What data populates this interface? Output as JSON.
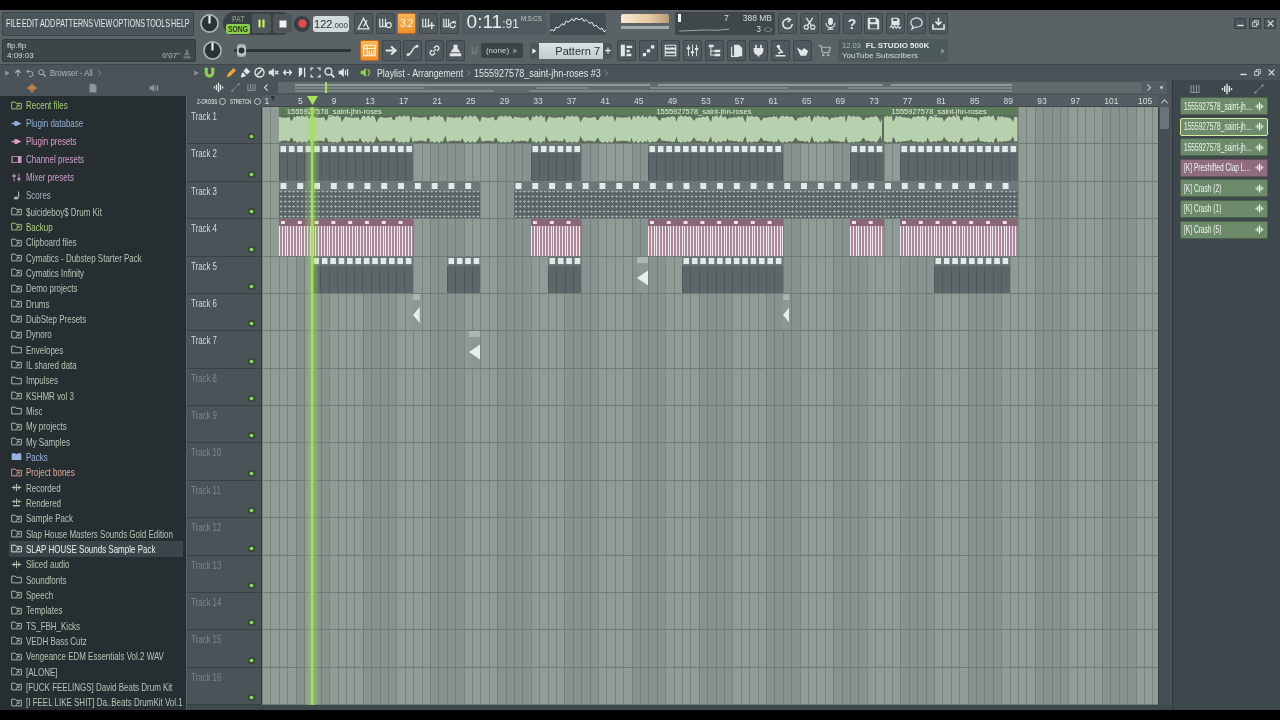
{
  "menu": [
    "FILE",
    "EDIT",
    "ADD",
    "PATTERNS",
    "VIEW",
    "OPTIONS",
    "TOOLS",
    "HELP"
  ],
  "project": {
    "file": "flp.flp",
    "position": "4:09:03",
    "duration": "0'07\""
  },
  "transport": {
    "modes": [
      {
        "label": "PAT",
        "selected": false
      },
      {
        "label": "SONG",
        "selected": true
      }
    ],
    "playing": true,
    "tempo": "122",
    "tempo_decimals": ".000"
  },
  "record_options": [
    {
      "kind": "metronome",
      "on": false
    },
    {
      "kind": "wait",
      "on": false
    },
    {
      "kind": "countdown",
      "label": "3.2",
      "on": true
    },
    {
      "kind": "blend",
      "on": false
    },
    {
      "kind": "loop",
      "on": false
    }
  ],
  "time": {
    "value": "0:11",
    "centiseconds": ":91",
    "unit": "M:S:CS"
  },
  "monitor": {
    "readout_1": "7",
    "memory": "388 MB",
    "readout_2": "3"
  },
  "help": {
    "label": "?"
  },
  "song_position": {
    "level": 0.06
  },
  "view_buttons": [
    {
      "kind": "playlist",
      "on": true
    },
    {
      "kind": "arrow",
      "on": false
    },
    {
      "kind": "curve",
      "on": false
    },
    {
      "kind": "link",
      "on": false
    },
    {
      "kind": "stamp",
      "on": false
    }
  ],
  "snap": {
    "value": "(none)"
  },
  "pattern": {
    "value": "Pattern 7"
  },
  "news": {
    "date": "12.03",
    "headline": "FL STUDIO 500K",
    "text": "YouTube Subscribers"
  },
  "browser": {
    "title": "Browser - All",
    "items": [
      {
        "label": "Recent files",
        "kind": "recent",
        "selected": false
      },
      {
        "label": "Plugin database",
        "kind": "plugin-db",
        "selected": false
      },
      {
        "label": "Plugin presets",
        "kind": "plugin-presets",
        "selected": false
      },
      {
        "label": "Channel presets",
        "kind": "channel-presets",
        "selected": false
      },
      {
        "label": "Mixer presets",
        "kind": "mixer-presets",
        "selected": false
      },
      {
        "label": "Scores",
        "kind": "scores",
        "selected": false
      },
      {
        "label": "$uicideboy$ Drum Kit",
        "kind": "link",
        "selected": false
      },
      {
        "label": "Backup",
        "kind": "backup",
        "selected": false
      },
      {
        "label": "Clipboard files",
        "kind": "link",
        "selected": false
      },
      {
        "label": "Cymatics - Dubstep Starter Pack",
        "kind": "link",
        "selected": false
      },
      {
        "label": "Cymatics Infinity",
        "kind": "link",
        "selected": false
      },
      {
        "label": "Demo projects",
        "kind": "link",
        "selected": false
      },
      {
        "label": "Drums",
        "kind": "link",
        "selected": false
      },
      {
        "label": "DubStep Presets",
        "kind": "link",
        "selected": false
      },
      {
        "label": "Dynoro",
        "kind": "link",
        "selected": false
      },
      {
        "label": "Envelopes",
        "kind": "folder",
        "selected": false
      },
      {
        "label": "IL shared data",
        "kind": "link",
        "selected": false
      },
      {
        "label": "Impulses",
        "kind": "folder",
        "selected": false
      },
      {
        "label": "KSHMR vol 3",
        "kind": "link",
        "selected": false
      },
      {
        "label": "Misc",
        "kind": "folder",
        "selected": false
      },
      {
        "label": "My projects",
        "kind": "link",
        "selected": false
      },
      {
        "label": "My Samples",
        "kind": "link",
        "selected": false
      },
      {
        "label": "Packs",
        "kind": "packs",
        "selected": false
      },
      {
        "label": "Project bones",
        "kind": "bones",
        "selected": false
      },
      {
        "label": "Recorded",
        "kind": "recorded",
        "selected": false
      },
      {
        "label": "Rendered",
        "kind": "rendered",
        "selected": false
      },
      {
        "label": "Sample Pack",
        "kind": "link",
        "selected": false
      },
      {
        "label": "Slap House Masters Sounds Gold Edition",
        "kind": "link",
        "selected": false
      },
      {
        "label": "SLAP HOUSE Sounds Sample Pack",
        "kind": "link",
        "selected": true
      },
      {
        "label": "Sliced audio",
        "kind": "sliced",
        "selected": false
      },
      {
        "label": "Soundfonts",
        "kind": "folder",
        "selected": false
      },
      {
        "label": "Speech",
        "kind": "link",
        "selected": false
      },
      {
        "label": "Templates",
        "kind": "link",
        "selected": false
      },
      {
        "label": "TS_FBH_Kicks",
        "kind": "link",
        "selected": false
      },
      {
        "label": "VEDH Bass Cutz",
        "kind": "link",
        "selected": false
      },
      {
        "label": "Vengeance EDM Essentials Vol.2 WAV",
        "kind": "link",
        "selected": false
      },
      {
        "label": "[ALONE]",
        "kind": "link",
        "selected": false
      },
      {
        "label": "[FUCK FEELINGS] David Beats Drum Kit",
        "kind": "link",
        "selected": false
      },
      {
        "label": "[I FEEL LIKE SHIT] Da..Beats DrumKit Vol.1",
        "kind": "link",
        "selected": false
      }
    ]
  },
  "playlist": {
    "title": "Playlist - Arrangement",
    "arrangement": "1555927578_saint-jhn-roses #3",
    "options": [
      {
        "label": "Z-CROSS",
        "checked": false
      },
      {
        "label": "STRETCH",
        "checked": false
      }
    ],
    "ruler": [
      "1",
      "5",
      "9",
      "13",
      "17",
      "21",
      "25",
      "29",
      "33",
      "37",
      "41",
      "45",
      "49",
      "53",
      "57",
      "61",
      "65",
      "69",
      "73",
      "77",
      "81",
      "85",
      "89",
      "93",
      "97",
      "101",
      "105"
    ],
    "tracks": [
      {
        "name": "Track 1",
        "on": true,
        "clips": [
          {
            "kind": "audio",
            "label": "1555927578_saint-jhn-roses"
          },
          {
            "kind": "audio",
            "label": "1555927578_saint-jhn-roses"
          },
          {
            "kind": "audio",
            "label": "1555927578_saint-jhn-roses"
          }
        ]
      },
      {
        "name": "Track 2",
        "on": true,
        "clips": [
          {
            "kind": "pattern"
          },
          {
            "kind": "pattern"
          },
          {
            "kind": "pattern"
          },
          {
            "kind": "pattern"
          },
          {
            "kind": "pattern"
          }
        ]
      },
      {
        "name": "Track 3",
        "on": true,
        "clips": [
          {
            "kind": "beat"
          },
          {
            "kind": "beat"
          }
        ]
      },
      {
        "name": "Track 4",
        "on": true,
        "clips": [
          {
            "kind": "clap"
          },
          {
            "kind": "clap"
          },
          {
            "kind": "clap"
          },
          {
            "kind": "clap"
          },
          {
            "kind": "clap"
          }
        ]
      },
      {
        "name": "Track 5",
        "on": true,
        "clips": [
          {
            "kind": "pattern"
          },
          {
            "kind": "pattern"
          },
          {
            "kind": "pattern"
          },
          {
            "kind": "hit"
          },
          {
            "kind": "pattern"
          },
          {
            "kind": "pattern"
          }
        ]
      },
      {
        "name": "Track 6",
        "on": true,
        "clips": [
          {
            "kind": "hit"
          },
          {
            "kind": "hit"
          }
        ]
      },
      {
        "name": "Track 7",
        "on": true,
        "clips": [
          {
            "kind": "hit"
          }
        ]
      },
      {
        "name": "Track 8",
        "on": true
      },
      {
        "name": "Track 9",
        "on": true
      },
      {
        "name": "Track 10",
        "on": true
      },
      {
        "name": "Track 11",
        "on": true
      },
      {
        "name": "Track 12",
        "on": true
      },
      {
        "name": "Track 13",
        "on": true
      },
      {
        "name": "Track 14",
        "on": true
      },
      {
        "name": "Track 15",
        "on": true
      },
      {
        "name": "Track 16",
        "on": true
      }
    ]
  },
  "picker": {
    "items": [
      {
        "label": "1555927578_saint-jh…",
        "color": "#6d8b6a",
        "selected": false
      },
      {
        "label": "1555927578_saint-jh…",
        "color": "#6d8b6a",
        "selected": true
      },
      {
        "label": "1555927578_saint-jh…",
        "color": "#6d8b6a",
        "selected": false
      },
      {
        "label": "[K] Preshifted Clap L…",
        "color": "#8f6d7c",
        "selected": false
      },
      {
        "label": "[K] Crash (2)",
        "color": "#6d8b6a",
        "selected": false
      },
      {
        "label": "[K] Crash (1)",
        "color": "#6d8b6a",
        "selected": false
      },
      {
        "label": "[K] Crash (5)",
        "color": "#6d8b6a",
        "selected": false
      }
    ]
  }
}
